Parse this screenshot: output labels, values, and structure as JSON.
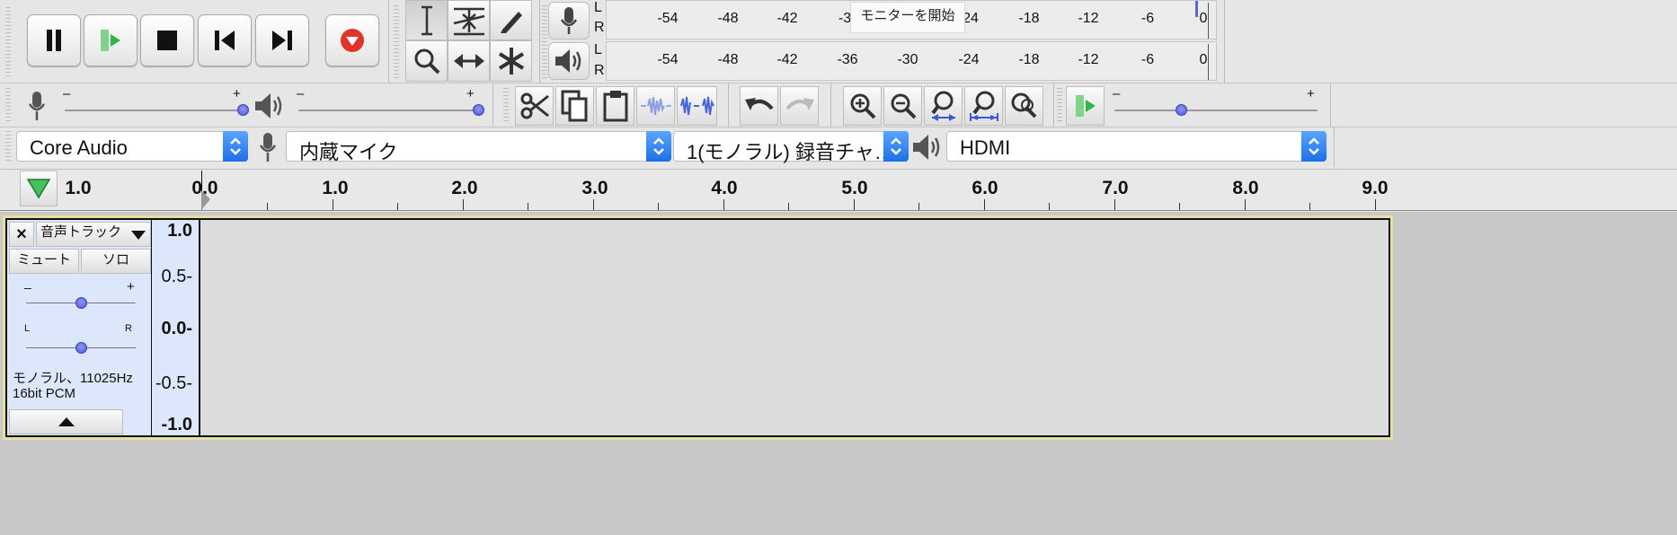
{
  "transport": {
    "pause_label": "Pause",
    "play_label": "Play",
    "stop_label": "Stop",
    "skip_start_label": "Skip to Start",
    "skip_end_label": "Skip to End",
    "record_label": "Record"
  },
  "meters": {
    "record": {
      "channels": [
        "L",
        "R"
      ],
      "scale": [
        "-54",
        "-48",
        "-42",
        "-3",
        "24",
        "-18",
        "-12",
        "-6",
        "0"
      ],
      "overlay_label": "モニターを開始"
    },
    "playback": {
      "channels": [
        "L",
        "R"
      ],
      "scale": [
        "-54",
        "-48",
        "-42",
        "-36",
        "-30",
        "-24",
        "-18",
        "-12",
        "-6",
        "0"
      ]
    }
  },
  "mixer": {
    "record_volume": {
      "minus": "–",
      "plus": "+",
      "level": 1.0
    },
    "playback_volume": {
      "minus": "–",
      "plus": "+",
      "level": 1.0
    }
  },
  "play_at_speed": {
    "minus": "–",
    "plus": "+",
    "level": 0.33
  },
  "devices": {
    "host": "Core Audio",
    "input_device": "内蔵マイク",
    "channels": "1(モノラル) 録音チャ…",
    "output_device": "HDMI"
  },
  "timeline": {
    "ticks": [
      "1.0",
      "0.0",
      "1.0",
      "2.0",
      "3.0",
      "4.0",
      "5.0",
      "6.0",
      "7.0",
      "8.0",
      "9.0"
    ]
  },
  "track": {
    "close_label": "×",
    "name": "音声トラック",
    "mute_label": "ミュート",
    "solo_label": "ソロ",
    "gain": {
      "minus": "–",
      "plus": "+",
      "level": 0.5
    },
    "pan": {
      "left": "L",
      "right": "R",
      "level": 0.5
    },
    "info_line1": "モノラル、11025Hz",
    "info_line2": "16bit PCM",
    "collapse_label": "▲",
    "vertical_scale": [
      "1.0",
      "0.5-",
      "0.0-",
      "-0.5-",
      "-1.0"
    ]
  },
  "colors": {
    "record_red": "#e0332a",
    "play_green": "#33b34a",
    "slider_blue": "#5060e0",
    "combo_blue": "#2a7cf0",
    "track_bg": "#dcdcdc",
    "track_panel": "#dde7fb",
    "track_border": "#e6e0a0"
  }
}
